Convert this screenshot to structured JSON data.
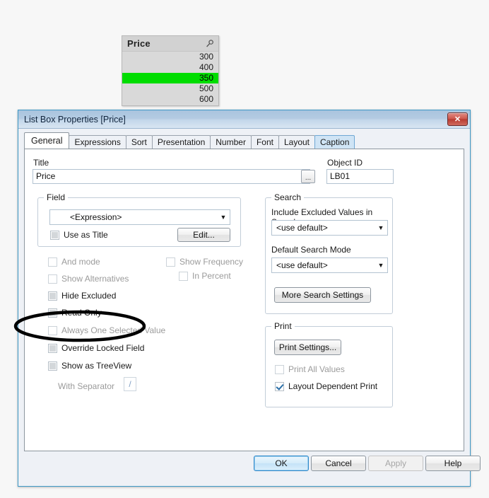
{
  "listbox": {
    "title": "Price",
    "search_icon": "search-icon",
    "rows": [
      {
        "value": "300",
        "selected": false
      },
      {
        "value": "400",
        "selected": false
      },
      {
        "value": "350",
        "selected": true
      },
      {
        "value": "500",
        "selected": false
      },
      {
        "value": "600",
        "selected": false
      }
    ],
    "selected_color": "#00dd00",
    "background_color": "#d9d9d9"
  },
  "dialog": {
    "title": "List Box Properties [Price]",
    "close_label": "✕",
    "tabs": [
      {
        "label": "General",
        "state": "active"
      },
      {
        "label": "Expressions",
        "state": "normal"
      },
      {
        "label": "Sort",
        "state": "normal"
      },
      {
        "label": "Presentation",
        "state": "normal"
      },
      {
        "label": "Number",
        "state": "normal"
      },
      {
        "label": "Font",
        "state": "normal"
      },
      {
        "label": "Layout",
        "state": "normal"
      },
      {
        "label": "Caption",
        "state": "highlight"
      }
    ],
    "title_field": {
      "label": "Title",
      "value": "Price",
      "browse_button": "..."
    },
    "object_id": {
      "label": "Object ID",
      "value": "LB01"
    },
    "field_group": {
      "legend": "Field",
      "combo_value": "<Expression>",
      "use_as_title": {
        "label": "Use as Title",
        "checked": false
      },
      "edit_button": "Edit..."
    },
    "options": [
      {
        "label": "And mode",
        "checked": false,
        "enabled": false,
        "col": "left"
      },
      {
        "label": "Show Alternatives",
        "checked": false,
        "enabled": false,
        "col": "left"
      },
      {
        "label": "Hide Excluded",
        "checked": false,
        "enabled": true,
        "col": "left"
      },
      {
        "label": "Read Only",
        "checked": false,
        "enabled": true,
        "col": "left"
      },
      {
        "label": "Always One Selected Value",
        "checked": false,
        "enabled": false,
        "col": "left"
      },
      {
        "label": "Override Locked Field",
        "checked": false,
        "enabled": true,
        "col": "left"
      },
      {
        "label": "Show as TreeView",
        "checked": false,
        "enabled": true,
        "col": "left"
      }
    ],
    "right_options": [
      {
        "label": "Show Frequency",
        "checked": false,
        "enabled": false
      },
      {
        "label": "In Percent",
        "checked": false,
        "enabled": false
      }
    ],
    "separator": {
      "label": "With Separator",
      "value": "/"
    },
    "search_group": {
      "legend": "Search",
      "include_excluded_label": "Include Excluded Values in Search",
      "include_excluded_value": "<use default>",
      "default_search_mode_label": "Default Search Mode",
      "default_search_mode_value": "<use default>",
      "more_settings_button": "More Search Settings"
    },
    "print_group": {
      "legend": "Print",
      "print_settings_button": "Print Settings...",
      "print_all_values": {
        "label": "Print All Values",
        "checked": false
      },
      "layout_dependent_print": {
        "label": "Layout Dependent Print",
        "checked": true
      }
    },
    "buttons": [
      {
        "label": "OK",
        "style": "default"
      },
      {
        "label": "Cancel",
        "style": "normal"
      },
      {
        "label": "Apply",
        "style": "disabled"
      },
      {
        "label": "Help",
        "style": "normal"
      }
    ]
  },
  "annotation": {
    "shape": "ellipse",
    "target": "Always One Selected Value",
    "color": "#000000"
  }
}
